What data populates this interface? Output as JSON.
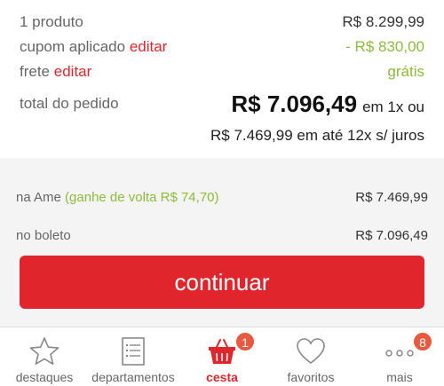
{
  "summary": {
    "products_label": "1 produto",
    "products_value": "R$ 8.299,99",
    "coupon_label": "cupom aplicado",
    "coupon_edit": "editar",
    "coupon_value": "- R$ 830,00",
    "shipping_label": "frete",
    "shipping_edit": "editar",
    "shipping_value": "grátis",
    "total_label": "total do pedido",
    "total_value": "R$ 7.096,49",
    "total_suffix": "em 1x ou",
    "installments": "R$ 7.469,99 em até 12x s/ juros"
  },
  "payment": {
    "ame_label": "na Ame",
    "ame_cashback": "(ganhe de volta R$ 74,70)",
    "ame_value": "R$ 7.469,99",
    "boleto_label": "no boleto",
    "boleto_value": "R$ 7.096,49"
  },
  "cta": {
    "label": "continuar"
  },
  "tabs": [
    {
      "label": "destaques",
      "icon": "star-icon"
    },
    {
      "label": "departamentos",
      "icon": "list-icon"
    },
    {
      "label": "cesta",
      "icon": "basket-icon",
      "badge": "1",
      "active": true
    },
    {
      "label": "favoritos",
      "icon": "heart-icon"
    },
    {
      "label": "mais",
      "icon": "more-icon",
      "badge": "8"
    }
  ],
  "colors": {
    "accent": "#e0262c",
    "green": "#8dbb3a",
    "badge": "#e85a3f"
  }
}
